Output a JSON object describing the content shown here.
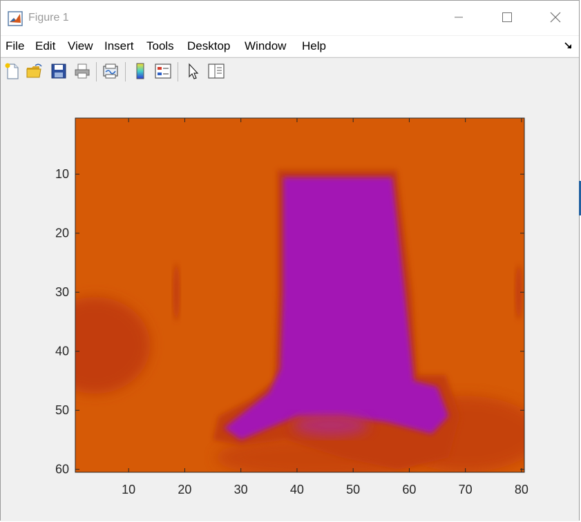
{
  "window": {
    "title": "Figure 1",
    "controls": [
      "minimize",
      "maximize",
      "close"
    ]
  },
  "menu": {
    "items": [
      "File",
      "Edit",
      "View",
      "Insert",
      "Tools",
      "Desktop",
      "Window",
      "Help"
    ]
  },
  "toolbar": {
    "buttons": [
      {
        "name": "new-figure",
        "icon": "new-file-icon"
      },
      {
        "name": "open-file",
        "icon": "folder-open-icon"
      },
      {
        "name": "save-figure",
        "icon": "save-icon"
      },
      {
        "name": "print-figure",
        "icon": "print-icon"
      },
      {
        "name": "link-plot",
        "icon": "link-plot-icon"
      },
      {
        "name": "insert-colorbar",
        "icon": "colorbar-icon"
      },
      {
        "name": "insert-legend",
        "icon": "legend-icon"
      },
      {
        "name": "edit-plot",
        "icon": "pointer-icon"
      },
      {
        "name": "property-inspector",
        "icon": "inspector-icon"
      }
    ]
  },
  "chart_data": {
    "type": "heatmap",
    "title": "",
    "xlabel": "",
    "ylabel": "",
    "xlim": [
      0.5,
      80.5
    ],
    "ylim": [
      0.5,
      60.5
    ],
    "y_direction": "reverse",
    "xticks": [
      10,
      20,
      30,
      40,
      50,
      60,
      70,
      80
    ],
    "yticks": [
      10,
      20,
      30,
      40,
      50,
      60
    ],
    "colors": {
      "background": "#D65A06",
      "dark_region": "#C23D0C",
      "object": "#A315B4",
      "object_edge": "#B02A86"
    },
    "regions": [
      {
        "label": "object-top",
        "x": [
          37,
          58
        ],
        "y": [
          10,
          34
        ]
      },
      {
        "label": "object-base",
        "x": [
          27,
          67
        ],
        "y": [
          45,
          55
        ]
      },
      {
        "label": "dark-left",
        "x": [
          1,
          11
        ],
        "y": [
          30,
          45
        ]
      },
      {
        "label": "dark-right",
        "x": [
          60,
          80
        ],
        "y": [
          46,
          60
        ]
      }
    ]
  }
}
